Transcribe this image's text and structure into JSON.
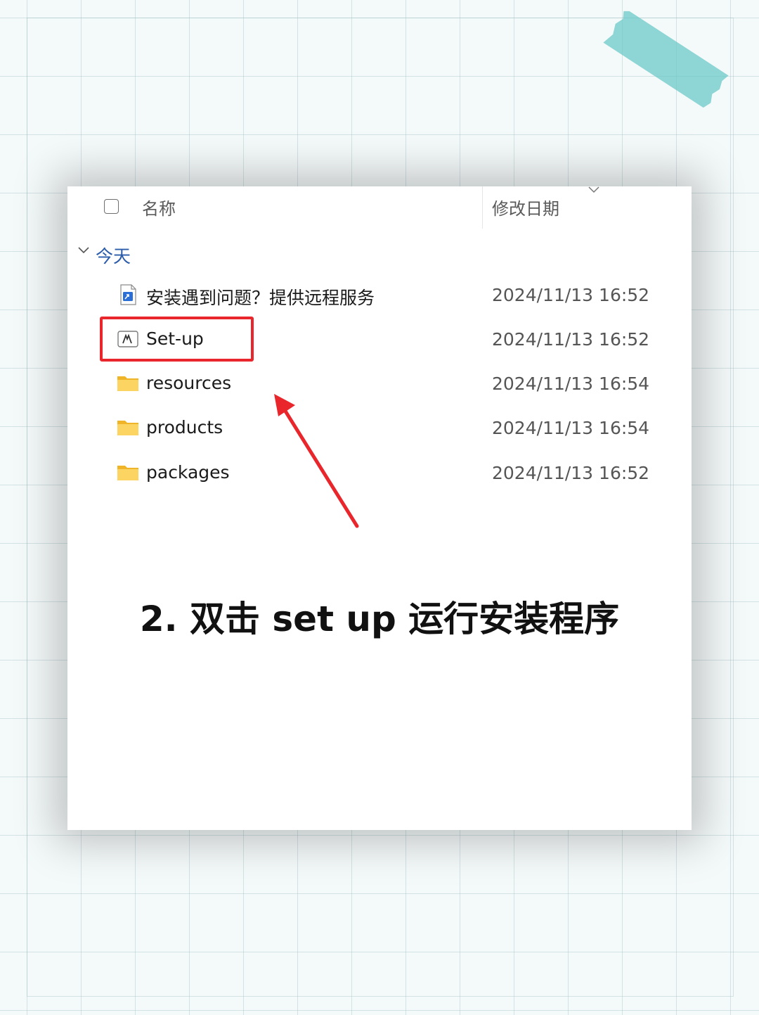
{
  "header": {
    "name_label": "名称",
    "date_label": "修改日期"
  },
  "group": {
    "label": "今天"
  },
  "files": [
    {
      "name": "安装遇到问题？提供远程服务",
      "date": "2024/11/13 16:52",
      "icon": "shortcut-file-icon"
    },
    {
      "name": "Set-up",
      "date": "2024/11/13 16:52",
      "icon": "adobe-setup-icon"
    },
    {
      "name": "resources",
      "date": "2024/11/13 16:54",
      "icon": "folder-icon"
    },
    {
      "name": "products",
      "date": "2024/11/13 16:54",
      "icon": "folder-icon"
    },
    {
      "name": "packages",
      "date": "2024/11/13 16:52",
      "icon": "folder-icon"
    }
  ],
  "caption": "2. 双击 set up 运行安装程序",
  "colors": {
    "highlight": "#e8262b",
    "arrow": "#e8262b",
    "group_label": "#2a5caa",
    "folder": "#f9c94a"
  }
}
